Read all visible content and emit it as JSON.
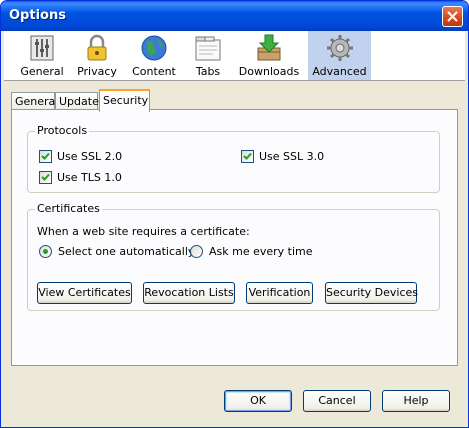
{
  "window": {
    "title": "Options"
  },
  "toolbar": {
    "items": [
      {
        "label": "General",
        "icon": "general-icon"
      },
      {
        "label": "Privacy",
        "icon": "padlock-icon"
      },
      {
        "label": "Content",
        "icon": "globe-icon"
      },
      {
        "label": "Tabs",
        "icon": "tabs-icon"
      },
      {
        "label": "Downloads",
        "icon": "downloads-icon"
      },
      {
        "label": "Advanced",
        "icon": "gear-icon",
        "selected": true
      }
    ]
  },
  "tabs": [
    {
      "label": "General"
    },
    {
      "label": "Update"
    },
    {
      "label": "Security",
      "selected": true
    }
  ],
  "protocols": {
    "legend": "Protocols",
    "ssl2": {
      "label": "Use SSL 2.0",
      "checked": true
    },
    "ssl3": {
      "label": "Use SSL 3.0",
      "checked": true
    },
    "tls1": {
      "label": "Use TLS 1.0",
      "checked": true
    }
  },
  "certificates": {
    "legend": "Certificates",
    "prompt": "When a web site requires a certificate:",
    "options": [
      {
        "label": "Select one automatically",
        "selected": true
      },
      {
        "label": "Ask me every time",
        "selected": false
      }
    ],
    "buttons": {
      "view": "View Certificates",
      "revocation": "Revocation Lists",
      "verification": "Verification",
      "devices": "Security Devices"
    }
  },
  "dialog_buttons": {
    "ok": "OK",
    "cancel": "Cancel",
    "help": "Help"
  },
  "colors": {
    "titlebar": "#0054e3",
    "tab_highlight": "#f9a72a",
    "selected_toolbar": "#c1d2ee",
    "check": "#21a121"
  }
}
